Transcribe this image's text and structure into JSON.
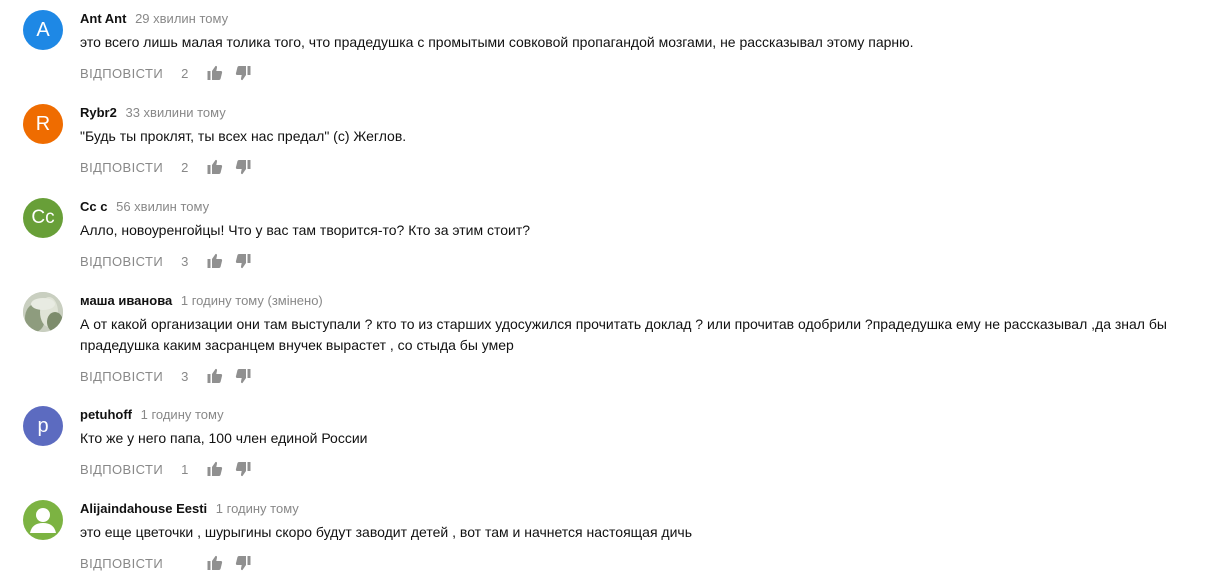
{
  "comments": [
    {
      "avatar_letter": "A",
      "avatar_color": "#1e88e5",
      "author": "Ant Ant",
      "time": "29 хвилин тому",
      "text": "это всего лишь малая толика того, что прадедушка с промытыми совковой пропагандой мозгами, не рассказывал этому парню.",
      "reply_label": "ВІДПОВІСТИ",
      "likes": "2"
    },
    {
      "avatar_letter": "R",
      "avatar_color": "#ef6c00",
      "author": "Rybr2",
      "time": "33 хвилини тому",
      "text": "\"Будь ты проклят, ты всех нас предал\" (с) Жеглов.",
      "reply_label": "ВІДПОВІСТИ",
      "likes": "2"
    },
    {
      "avatar_letter": "Cc",
      "avatar_color": "#689f38",
      "author": "Cc c",
      "time": "56 хвилин тому",
      "text": "Алло, новоуренгойцы! Что у вас там творится-то? Кто за этим стоит?",
      "reply_label": "ВІДПОВІСТИ",
      "likes": "3"
    },
    {
      "avatar_letter": "",
      "avatar_color": "#8a9a84",
      "author": "маша иванова",
      "time": "1 годину тому (змінено)",
      "text": "А от какой организации они там выступали ? кто то из старших удосужился прочитать доклад ? или прочитав одобрили ?прадедушка ему не рассказывал ,да знал бы прадедушка каким засранцем внучек вырастет , со стыда бы умер",
      "reply_label": "ВІДПОВІСТИ",
      "likes": "3"
    },
    {
      "avatar_letter": "p",
      "avatar_color": "#5c6bc0",
      "author": "petuhoff",
      "time": "1 годину тому",
      "text": "Кто же у него папа, 100 член единой России",
      "reply_label": "ВІДПОВІСТИ",
      "likes": "1"
    },
    {
      "avatar_letter": "",
      "avatar_color": "#7cb342",
      "author": "Alijaindahouse Eesti",
      "time": "1 годину тому",
      "text": "это еще цветочки , шурыгины скоро будут заводит детей , вот там и начнется настоящая дичь",
      "reply_label": "ВІДПОВІСТИ",
      "likes": ""
    }
  ]
}
